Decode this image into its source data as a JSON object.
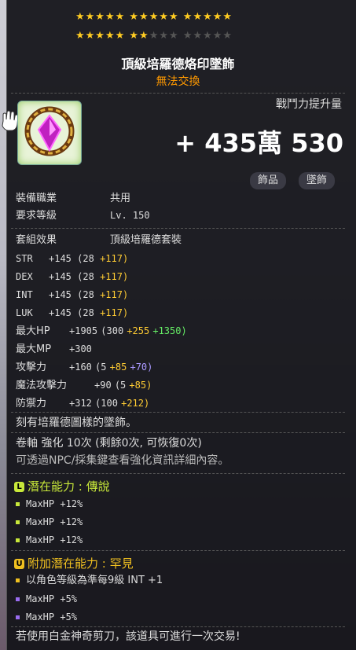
{
  "stars": {
    "row1": "★★★★★  ★★★★★  ★★★★★",
    "row2_on": "★★★★★  ★★",
    "row2_off": "★★★  ★★★★★"
  },
  "item": {
    "name": "頂級培羅德烙印墜飾",
    "trade": "無法交換"
  },
  "power": {
    "label": "戰鬥力提升量",
    "value": "+ 435萬 530"
  },
  "tags": [
    "飾品",
    "墜飾"
  ],
  "req": {
    "job_label": "裝備職業",
    "job_value": "共用",
    "level_label": "要求等級",
    "level_value": "Lv. 150"
  },
  "set": {
    "label": "套組效果",
    "value": "頂級培羅德套裝"
  },
  "stats": [
    {
      "name": "STR",
      "total": "+145",
      "base": "(28",
      "bonus": "+117)"
    },
    {
      "name": "DEX",
      "total": "+145",
      "base": "(28",
      "bonus": "+117)"
    },
    {
      "name": "INT",
      "total": "+145",
      "base": "(28",
      "bonus": "+117)"
    },
    {
      "name": "LUK",
      "total": "+145",
      "base": "(28",
      "bonus": "+117)"
    },
    {
      "name": "最大HP",
      "total": "+1905",
      "base": "(300",
      "bonus": "+255",
      "extra": "+1350)"
    },
    {
      "name": "最大MP",
      "total": "+300"
    },
    {
      "name": "攻擊力",
      "total": "+160",
      "base": "(5",
      "bonus": "+85",
      "star": "+70)"
    },
    {
      "name": "魔法攻擊力",
      "total": "+90",
      "base": "(5",
      "bonus": "+85)"
    },
    {
      "name": "防禦力",
      "total": "+312",
      "base": "(100",
      "bonus": "+212)"
    }
  ],
  "desc": "刻有培羅德圖樣的墜飾。",
  "scroll": {
    "line1": "卷軸 強化 10次 (剩餘0次, 可恢復0次)",
    "line2": "可透過NPC/採集鍵查看強化資訊詳細內容。"
  },
  "potential": {
    "badge": "L",
    "title": "潛在能力 : 傳說",
    "color": "#c8e83a",
    "lines": [
      "MaxHP +12%",
      "MaxHP +12%",
      "MaxHP +12%"
    ]
  },
  "bonus_potential": {
    "badge": "U",
    "title": "附加潛在能力 : 罕見",
    "color": "#f0c020",
    "lines": [
      "以角色等級為準每9級 INT +1",
      "MaxHP +5%",
      "MaxHP +5%"
    ],
    "bullet_colors": [
      "#f0c020",
      "#9a6cf0",
      "#9a6cf0"
    ]
  },
  "footer": "若使用白金神奇剪刀，該道具可進行一次交易!"
}
